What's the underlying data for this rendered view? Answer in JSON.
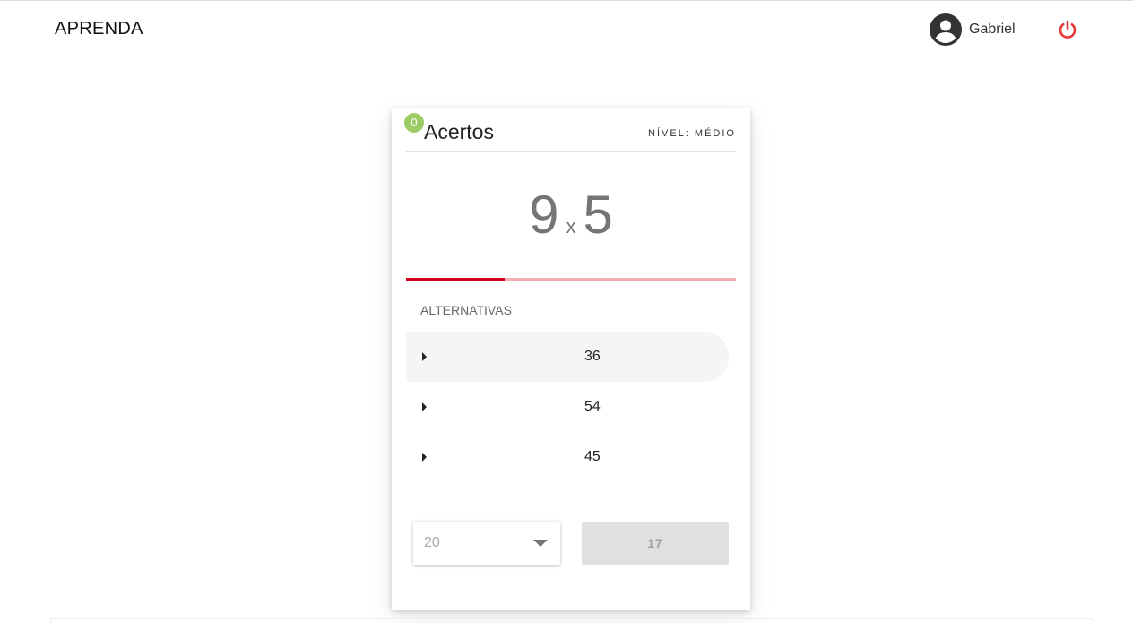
{
  "app": {
    "title": "APRENDA"
  },
  "user": {
    "name": "Gabriel",
    "avatar_icon": "account-circle-icon",
    "logout_icon": "power-icon",
    "logout_color": "#e53935"
  },
  "card": {
    "score": "0",
    "score_label": "Acertos",
    "level": "NÍVEL: MÉDIO",
    "question": {
      "a": "9",
      "operator": "x",
      "b": "5"
    },
    "progress": 0.3,
    "alternatives_title": "ALTERNATIVAS",
    "alternatives": [
      {
        "value": "36"
      },
      {
        "value": "54"
      },
      {
        "value": "45"
      }
    ],
    "select": {
      "value": "20"
    },
    "submit_label": "17"
  },
  "colors": {
    "accent": "#d0021b",
    "progress_track": "#f3aeb4",
    "badge": "#9ccc65"
  }
}
